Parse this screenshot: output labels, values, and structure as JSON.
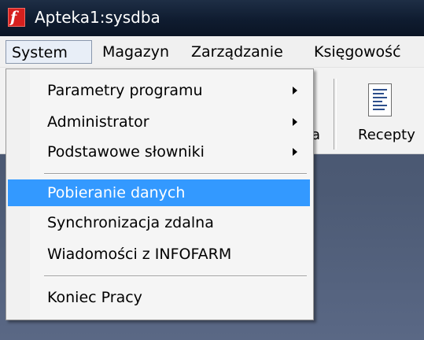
{
  "window": {
    "title": "Apteka1:sysdba",
    "icon_glyph": "f"
  },
  "menubar": {
    "items": [
      {
        "label": "System",
        "open": true
      },
      {
        "label": "Magazyn",
        "open": false
      },
      {
        "label": "Zarządzanie",
        "open": false
      },
      {
        "label": "Księgowość",
        "open": false
      }
    ]
  },
  "toolbar": {
    "partial_label": "a",
    "recepty_label": "Recepty",
    "recepty_icon": "document-list-icon"
  },
  "system_menu": {
    "items": [
      {
        "label": "Parametry programu",
        "submenu": true
      },
      {
        "label": "Administrator",
        "submenu": true
      },
      {
        "label": "Podstawowe słowniki",
        "submenu": true
      },
      {
        "label": "Pobieranie danych",
        "submenu": false,
        "highlighted": true
      },
      {
        "label": "Synchronizacja zdalna",
        "submenu": false
      },
      {
        "label": "Wiadomości z INFOFARM",
        "submenu": false
      },
      {
        "label": "Koniec Pracy",
        "submenu": false
      }
    ]
  },
  "colors": {
    "highlight": "#3399ff",
    "workspace": "#4c5a74",
    "titlebar": "#0f1c30",
    "app_icon": "#d6201e"
  }
}
